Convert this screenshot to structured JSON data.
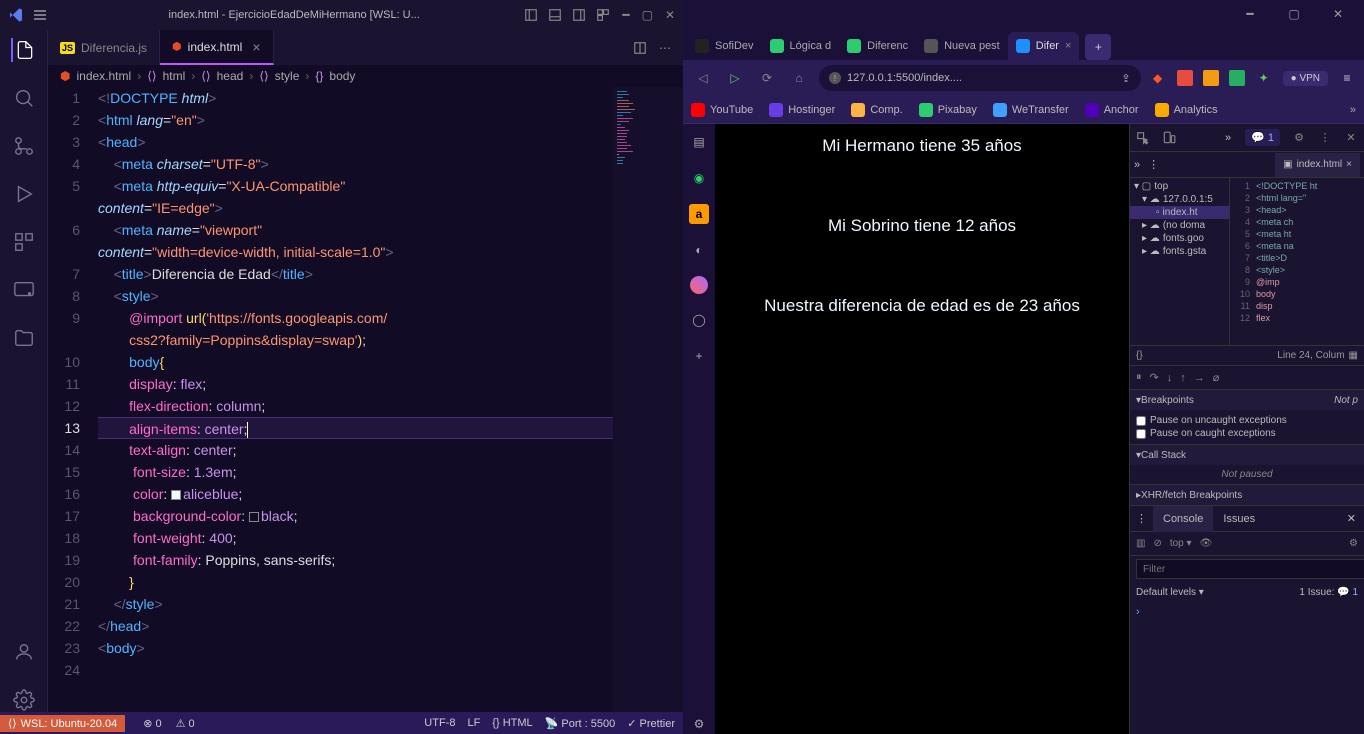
{
  "vscode": {
    "title": "index.html - EjercicioEdadDeMiHermano [WSL: U...",
    "tabs": [
      {
        "label": "Diferencia.js",
        "icon": "JS",
        "iconColor": "#f5de19",
        "active": false
      },
      {
        "label": "index.html",
        "icon": "<>",
        "iconColor": "#e44d26",
        "active": true,
        "dirty": true
      }
    ],
    "breadcrumb": {
      "items": [
        "index.html",
        "html",
        "head",
        "style",
        "body"
      ]
    },
    "code": {
      "lines": [
        "<!DOCTYPE html>",
        "<html lang=\"en\">",
        "<head>",
        "    <meta charset=\"UTF-8\">",
        "    <meta http-equiv=\"X-UA-Compatible\" content=\"IE=edge\">",
        "    <meta name=\"viewport\" content=\"width=device-width, initial-scale=1.0\">",
        "    <title>Diferencia de Edad</title>",
        "    <style>",
        "        @import url('https://fonts.googleapis.com/css2?family=Poppins&display=swap');",
        "        body{",
        "        display: flex;",
        "        flex-direction: column;",
        "        align-items: center;",
        "        text-align: center;",
        "         font-size: 1.3em;",
        "         color: aliceblue;",
        "         background-color: black;",
        "         font-weight: 400;",
        "         font-family: Poppins, sans-serifs;",
        "        }",
        "    </style>",
        "</head>",
        "<body>",
        ""
      ]
    },
    "status": {
      "wsl": "WSL: Ubuntu-20.04",
      "errors": "0",
      "warnings": "0",
      "encoding": "UTF-8",
      "eol": "LF",
      "lang": "HTML",
      "port": "Port : 5500",
      "prettier": "Prettier"
    }
  },
  "browser": {
    "tabs": [
      {
        "label": "SofiDev",
        "favColor": "#222"
      },
      {
        "label": "Lógica d",
        "favColor": "#2ecc71"
      },
      {
        "label": "Diferenc",
        "favColor": "#2ecc71"
      },
      {
        "label": "Nueva pest",
        "favColor": "#555"
      },
      {
        "label": "Difer",
        "favColor": "#1e90ff",
        "active": true
      }
    ],
    "url": "127.0.0.1:5500/index....",
    "bookmarks": [
      {
        "label": "YouTube",
        "color": "#ff0000"
      },
      {
        "label": "Hostinger",
        "color": "#673de6"
      },
      {
        "label": "Comp.",
        "color": "#ffb347"
      },
      {
        "label": "Pixabay",
        "color": "#2ecc71"
      },
      {
        "label": "WeTransfer",
        "color": "#409fff"
      },
      {
        "label": "Anchor",
        "color": "#5000b9"
      },
      {
        "label": "Analytics",
        "color": "#f9ab00"
      }
    ],
    "page": {
      "line1": "Mi Hermano tiene 35 años",
      "line2": "Mi Sobrino tiene 12 años",
      "line3": "Nuestra diferencia de edad es de 23 años"
    },
    "vpn": "VPN"
  },
  "devtools": {
    "issueCount": "1",
    "fileTab": "index.html",
    "tree": {
      "top": "top",
      "host": "127.0.0.1:5",
      "file": "index.ht",
      "noDomain": "(no doma",
      "fontsGoo": "fonts.goo",
      "fontsGsta": "fonts.gsta"
    },
    "source": [
      "<!DOCTYPE ht",
      "<html lang=\"",
      "<head>",
      "    <meta ch",
      "    <meta ht",
      "    <meta na",
      "    <title>D",
      "    <style>",
      "        @imp",
      "        body",
      "        disp",
      "        flex"
    ],
    "cursorInfo": "Line 24, Colum",
    "breakpoints": {
      "title": "Breakpoints",
      "notP": "Not p",
      "uncaught": "Pause on uncaught exceptions",
      "caught": "Pause on caught exceptions"
    },
    "callStack": {
      "title": "Call Stack",
      "state": "Not paused"
    },
    "xhr": "XHR/fetch Breakpoints",
    "console": {
      "tab1": "Console",
      "tab2": "Issues",
      "topLabel": "top",
      "filterPlaceholder": "Filter",
      "defaultLevels": "Default levels",
      "issueLabel": "1 Issue:",
      "issueNum": "1"
    }
  }
}
